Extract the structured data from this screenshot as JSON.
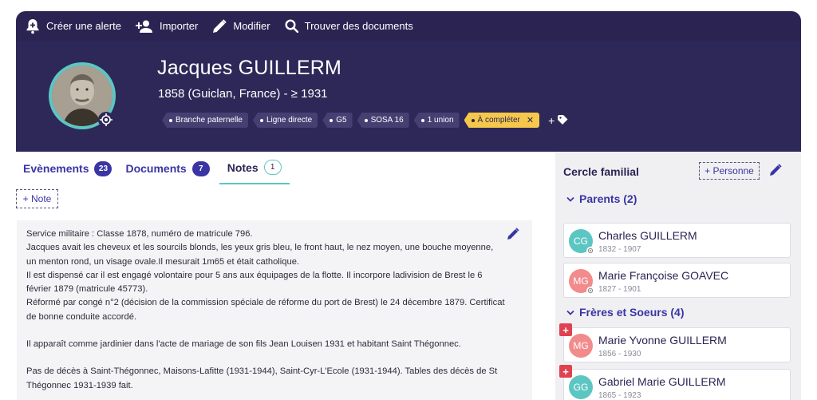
{
  "toolbar": {
    "create_alert": "Créer une alerte",
    "import": "Importer",
    "modify": "Modifier",
    "find_docs": "Trouver des documents"
  },
  "person": {
    "name": "Jacques GUILLERM",
    "dates": "1858 (Guiclan, France) - ≥ 1931",
    "tags": [
      {
        "label": "Branche paternelle",
        "style": "dark"
      },
      {
        "label": "Ligne directe",
        "style": "dark"
      },
      {
        "label": "G5",
        "style": "dark"
      },
      {
        "label": "SOSA 16",
        "style": "dark"
      },
      {
        "label": "1 union",
        "style": "dark"
      },
      {
        "label": "À compléter",
        "style": "yellow",
        "close": "✕"
      }
    ],
    "add_tag": "+"
  },
  "tabs": [
    {
      "label": "Evènements",
      "count": "23"
    },
    {
      "label": "Documents",
      "count": "7"
    },
    {
      "label": "Notes",
      "count": "1"
    }
  ],
  "note_add": "+ Note",
  "note": {
    "lines": [
      "Service militaire : Classe 1878, numéro de matricule 796.",
      "Jacques avait les cheveux et les sourcils blonds, les yeux gris bleu, le front haut, le nez moyen, une bouche moyenne, un menton rond, un visage ovale.Il mesurait 1m65 et était catholique.",
      "Il est dispensé car il est engagé volontaire pour 5 ans aux équipages de la flotte. Il incorpore ladivision de Brest le 6 février 1879 (matricule 45773).",
      "Réformé par congé n°2 (décision de la commission spéciale de réforme du port de Brest) le 24 décembre 1879. Certificat de bonne conduite accordé.",
      "",
      "Il apparaît comme jardinier dans l'acte de mariage de son fils Jean Louisen 1931 et habitant Saint Thégonnec.",
      "",
      "Pas de décès à Saint-Thégonnec, Maisons-Lafitte (1931-1944), Saint-Cyr-L'Ecole (1931-1944). Tables des décès de St Thégonnec 1931-1939 fait."
    ]
  },
  "family": {
    "title": "Cercle familial",
    "add_person": "+ Personne",
    "parents_title": "Parents (2)",
    "siblings_title": "Frères et Soeurs (4)",
    "parents": [
      {
        "initials": "CG",
        "name": "Charles GUILLERM",
        "dates": "1832 - 1907",
        "color": "#5cc6c2"
      },
      {
        "initials": "MG",
        "name": "Marie Françoise GOAVEC",
        "dates": "1827 - 1901",
        "color": "#f28b8b"
      }
    ],
    "siblings": [
      {
        "initials": "MG",
        "name": "Marie Yvonne GUILLERM",
        "dates": "1856 - 1930",
        "color": "#f28b8b"
      },
      {
        "initials": "GG",
        "name": "Gabriel Marie GUILLERM",
        "dates": "1865 - 1923",
        "color": "#5cc6c2"
      }
    ]
  },
  "colors": {
    "header_bg": "#2e2858",
    "accent_purple": "#3a35a3",
    "accent_teal": "#5cc6c2",
    "tag_yellow": "#f5c84c",
    "alert_red": "#e0424f"
  },
  "icons": [
    "bell-plus-icon",
    "add-person-icon",
    "pencil-icon",
    "search-icon",
    "target-icon",
    "tag-icon",
    "chevron-down-icon",
    "plus-badge-icon"
  ]
}
